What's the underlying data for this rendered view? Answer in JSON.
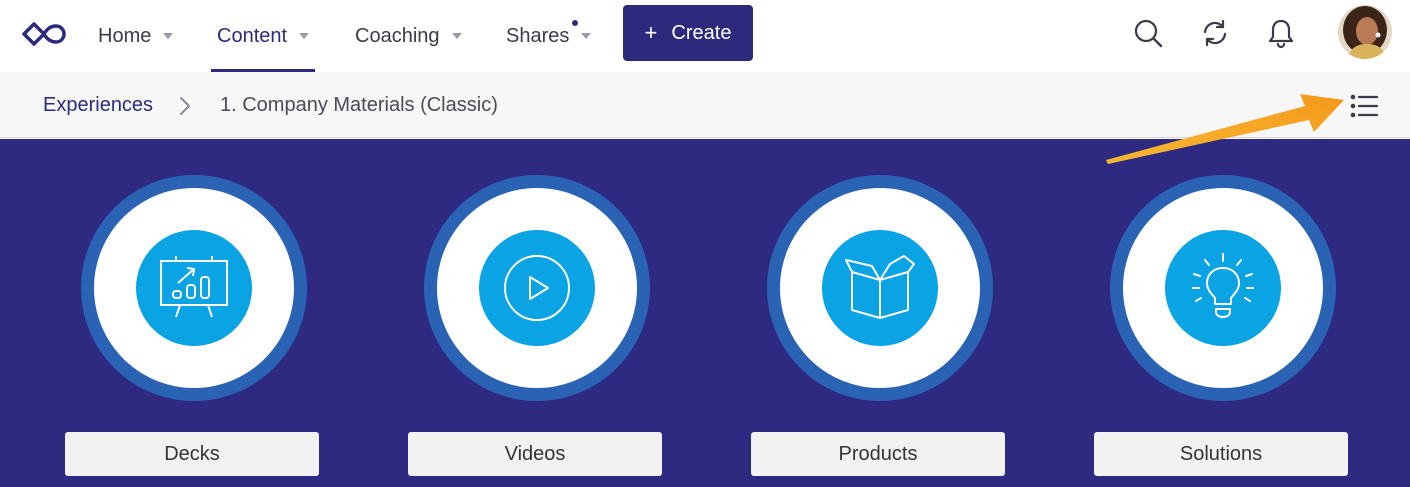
{
  "nav": {
    "home_label": "Home",
    "content_label": "Content",
    "coaching_label": "Coaching",
    "shares_label": "Shares",
    "create_label": "Create",
    "create_plus": "+"
  },
  "breadcrumb": {
    "parent": "Experiences",
    "current": "1. Company Materials (Classic)"
  },
  "tiles": [
    {
      "label": "Decks",
      "icon": "presentation-chart-icon"
    },
    {
      "label": "Videos",
      "icon": "play-circle-icon"
    },
    {
      "label": "Products",
      "icon": "open-box-icon"
    },
    {
      "label": "Solutions",
      "icon": "lightbulb-icon"
    }
  ],
  "colors": {
    "brand": "#2d2a7e",
    "main_background": "#2e2a82",
    "ring": "#2a63b4",
    "icon_circle": "#0aa3e3",
    "annotation_arrow": "#f5a623"
  }
}
